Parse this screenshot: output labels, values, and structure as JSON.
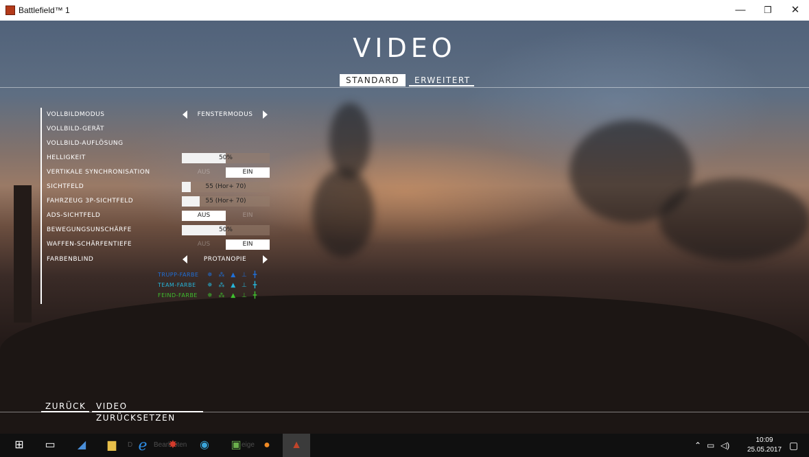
{
  "window": {
    "title": "Battlefield™ 1"
  },
  "page": {
    "title": "VIDEO"
  },
  "tabs": {
    "standard": "STANDARD",
    "advanced": "ERWEITERT"
  },
  "settings": [
    {
      "label": "VOLLBILDMODUS",
      "type": "selector",
      "value": "FENSTERMODUS",
      "enabled": true
    },
    {
      "label": "VOLLBILD-GERÄT",
      "type": "selector",
      "value": "",
      "enabled": false
    },
    {
      "label": "VOLLBILD-AUFLÖSUNG",
      "type": "selector",
      "value": "",
      "enabled": false
    },
    {
      "label": "HELLIGKEIT",
      "type": "slider",
      "value": "50%",
      "fraction": 0.5
    },
    {
      "label": "VERTIKALE SYNCHRONISATION",
      "type": "toggle",
      "off": "AUS",
      "on": "EIN",
      "state": "on"
    },
    {
      "label": "SICHTFELD",
      "type": "slider",
      "value": "55 (Hor+ 70)",
      "fraction": 0.1
    },
    {
      "label": "FAHRZEUG 3P-SICHTFELD",
      "type": "slider",
      "value": "55 (Hor+ 70)",
      "fraction": 0.2
    },
    {
      "label": "ADS-SICHTFELD",
      "type": "toggle",
      "off": "AUS",
      "on": "EIN",
      "state": "off"
    },
    {
      "label": "BEWEGUNGSUNSCHÄRFE",
      "type": "slider",
      "value": "50%",
      "fraction": 0.5
    },
    {
      "label": "WAFFEN-SCHÄRFENTIEFE",
      "type": "toggle",
      "off": "AUS",
      "on": "EIN",
      "state": "on"
    },
    {
      "label": "FARBENBLIND",
      "type": "selector",
      "value": "PROTANOPIE",
      "enabled": true
    }
  ],
  "colorblind_preview": [
    {
      "label": "TRUPP-FARBE",
      "icons": "✵ ⁂ ▲ ⊥ ╋",
      "color": "#1f6fd8"
    },
    {
      "label": "TEAM-FARBE",
      "icons": "✵ ⁂ ▲ ⊥ ╋",
      "color": "#26b4d8"
    },
    {
      "label": "FEIND-FARBE",
      "icons": "✵ ⁂ ▲ ⊥ ╋",
      "color": "#3fbf2e"
    }
  ],
  "footer": {
    "back": "ZURÜCK",
    "reset": "VIDEO ZURÜCKSETZEN"
  },
  "taskbar": {
    "faded_text_1": "D",
    "faded_text_2": "Bearbeiten",
    "faded_text_3": "eige",
    "time": "10:09",
    "date": "25.05.2017"
  }
}
